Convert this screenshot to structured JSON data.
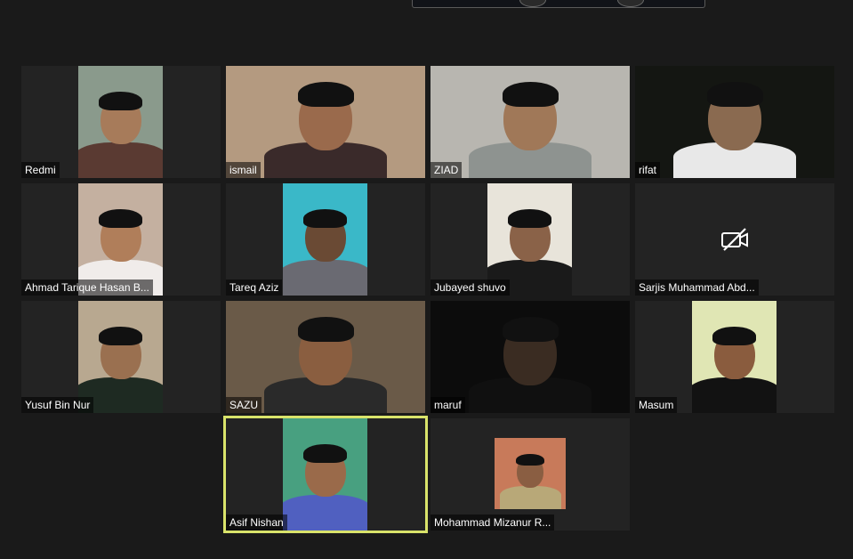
{
  "meeting": {
    "participants": [
      {
        "name": "Redmi",
        "video": "narrow",
        "bg": "#8a9a8c",
        "skin": "#a77b5a",
        "shirt": "#5a3a32"
      },
      {
        "name": "ismail",
        "video": "wide",
        "bg": "#b49a80",
        "skin": "#9a6a4c",
        "shirt": "#3a2a2a"
      },
      {
        "name": "ZIAD",
        "video": "wide",
        "bg": "#b8b6b0",
        "skin": "#a07858",
        "shirt": "#8e9390"
      },
      {
        "name": "rifat",
        "video": "wide",
        "bg": "#141612",
        "skin": "#8a6a50",
        "shirt": "#e8e8e8"
      },
      {
        "name": "Ahmad Tarique Hasan B...",
        "video": "narrow",
        "bg": "#c4b0a0",
        "skin": "#b07e5a",
        "shirt": "#f0ecea"
      },
      {
        "name": "Tareq Aziz",
        "video": "narrow",
        "bg": "#3ab8c8",
        "skin": "#6a4a34",
        "shirt": "#6a6a72"
      },
      {
        "name": "Jubayed shuvo",
        "video": "narrow",
        "bg": "#e8e4da",
        "skin": "#8a6248",
        "shirt": "#1a1a1a"
      },
      {
        "name": "Sarjis Muhammad Abd...",
        "video": "off",
        "bg": "#232323",
        "skin": "",
        "shirt": ""
      },
      {
        "name": "Yusuf Bin Nur",
        "video": "narrow",
        "bg": "#b8a890",
        "skin": "#9a7050",
        "shirt": "#1e2a22"
      },
      {
        "name": "SAZU",
        "video": "wide",
        "bg": "#6a5a48",
        "skin": "#8a5e40",
        "shirt": "#2a2a2a"
      },
      {
        "name": "maruf",
        "video": "wide",
        "bg": "#0c0c0c",
        "skin": "#3a2c22",
        "shirt": "#101010"
      },
      {
        "name": "Masum",
        "video": "narrow",
        "bg": "#e0e6b4",
        "skin": "#8a5c3e",
        "shirt": "#121212"
      },
      {
        "name": "Asif Nishan",
        "video": "narrow",
        "bg": "#48a080",
        "skin": "#9a6a4a",
        "shirt": "#5060c0",
        "active": true
      },
      {
        "name": "Mohammad Mizanur R...",
        "video": "small",
        "bg": "#c87a5a",
        "skin": "#8a5e42",
        "shirt": "#b8a878"
      }
    ]
  },
  "colors": {
    "background": "#1a1a1a",
    "tile": "#232323",
    "active_speaker": "#d9e36a"
  },
  "icons": {
    "camera_off": "video-off-icon"
  }
}
